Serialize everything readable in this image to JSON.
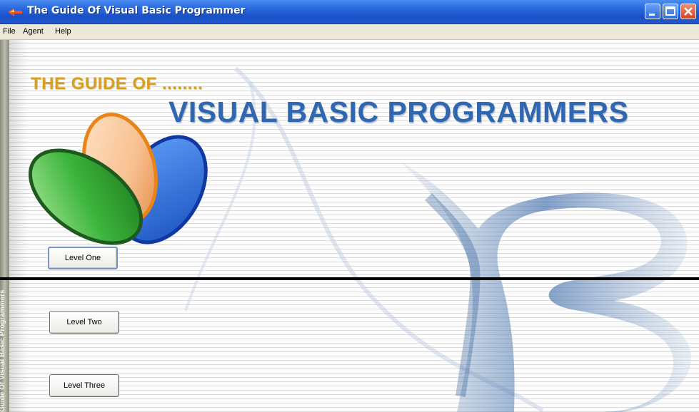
{
  "window": {
    "title": "The Guide Of Visual Basic Programmer"
  },
  "menu": {
    "file": "File",
    "agent": "Agent",
    "help": "Help"
  },
  "sidebar": {
    "caption": "Guide Of Visual Basic Programmers"
  },
  "banner": {
    "subtitle": "THE GUIDE OF ........",
    "title": "VISUAL BASIC PROGRAMMERS"
  },
  "buttons": {
    "level_one": "Level One",
    "level_two": "Level Two",
    "level_three": "Level Three"
  },
  "colors": {
    "subtitle": "#d8a020",
    "title": "#2f68b0",
    "titlebar": "#2a6ae0",
    "leaf_green": "#3cb43c",
    "leaf_orange": "#f0a050",
    "leaf_blue": "#2060d0"
  }
}
